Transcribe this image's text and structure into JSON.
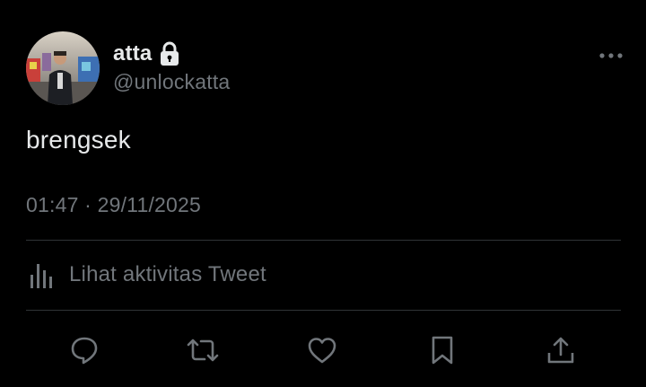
{
  "user": {
    "display_name": "atta",
    "handle": "@unlockatta",
    "protected_icon": "lock-icon",
    "avatar_icon": "avatar"
  },
  "tweet": {
    "text": "brengsek",
    "timestamp": "01:47 · 29/11/2025"
  },
  "activity": {
    "icon": "analytics-bars-icon",
    "label": "Lihat aktivitas Tweet"
  },
  "actions": [
    {
      "name": "reply",
      "icon": "reply-icon"
    },
    {
      "name": "retweet",
      "icon": "retweet-icon"
    },
    {
      "name": "like",
      "icon": "heart-icon"
    },
    {
      "name": "bookmark",
      "icon": "bookmark-icon"
    },
    {
      "name": "share",
      "icon": "share-icon"
    }
  ],
  "colors": {
    "background": "#000000",
    "primary_text": "#e7e9ea",
    "secondary_text": "#71767b",
    "divider": "#2f3336"
  }
}
